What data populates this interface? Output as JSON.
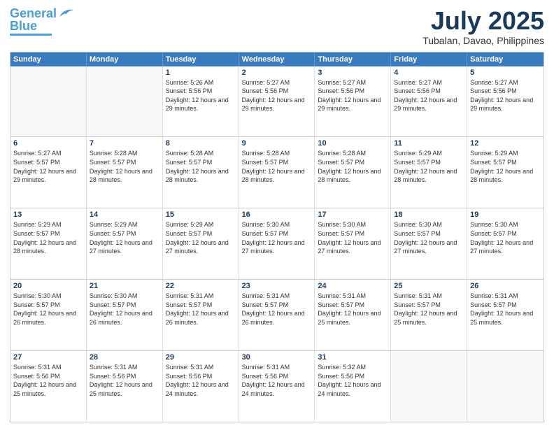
{
  "logo": {
    "line1": "General",
    "line2": "Blue"
  },
  "title": {
    "month_year": "July 2025",
    "location": "Tubalan, Davao, Philippines"
  },
  "calendar": {
    "headers": [
      "Sunday",
      "Monday",
      "Tuesday",
      "Wednesday",
      "Thursday",
      "Friday",
      "Saturday"
    ],
    "rows": [
      [
        {
          "day": "",
          "sunrise": "",
          "sunset": "",
          "daylight": ""
        },
        {
          "day": "",
          "sunrise": "",
          "sunset": "",
          "daylight": ""
        },
        {
          "day": "1",
          "sunrise": "Sunrise: 5:26 AM",
          "sunset": "Sunset: 5:56 PM",
          "daylight": "Daylight: 12 hours and 29 minutes."
        },
        {
          "day": "2",
          "sunrise": "Sunrise: 5:27 AM",
          "sunset": "Sunset: 5:56 PM",
          "daylight": "Daylight: 12 hours and 29 minutes."
        },
        {
          "day": "3",
          "sunrise": "Sunrise: 5:27 AM",
          "sunset": "Sunset: 5:56 PM",
          "daylight": "Daylight: 12 hours and 29 minutes."
        },
        {
          "day": "4",
          "sunrise": "Sunrise: 5:27 AM",
          "sunset": "Sunset: 5:56 PM",
          "daylight": "Daylight: 12 hours and 29 minutes."
        },
        {
          "day": "5",
          "sunrise": "Sunrise: 5:27 AM",
          "sunset": "Sunset: 5:56 PM",
          "daylight": "Daylight: 12 hours and 29 minutes."
        }
      ],
      [
        {
          "day": "6",
          "sunrise": "Sunrise: 5:27 AM",
          "sunset": "Sunset: 5:57 PM",
          "daylight": "Daylight: 12 hours and 29 minutes."
        },
        {
          "day": "7",
          "sunrise": "Sunrise: 5:28 AM",
          "sunset": "Sunset: 5:57 PM",
          "daylight": "Daylight: 12 hours and 28 minutes."
        },
        {
          "day": "8",
          "sunrise": "Sunrise: 5:28 AM",
          "sunset": "Sunset: 5:57 PM",
          "daylight": "Daylight: 12 hours and 28 minutes."
        },
        {
          "day": "9",
          "sunrise": "Sunrise: 5:28 AM",
          "sunset": "Sunset: 5:57 PM",
          "daylight": "Daylight: 12 hours and 28 minutes."
        },
        {
          "day": "10",
          "sunrise": "Sunrise: 5:28 AM",
          "sunset": "Sunset: 5:57 PM",
          "daylight": "Daylight: 12 hours and 28 minutes."
        },
        {
          "day": "11",
          "sunrise": "Sunrise: 5:29 AM",
          "sunset": "Sunset: 5:57 PM",
          "daylight": "Daylight: 12 hours and 28 minutes."
        },
        {
          "day": "12",
          "sunrise": "Sunrise: 5:29 AM",
          "sunset": "Sunset: 5:57 PM",
          "daylight": "Daylight: 12 hours and 28 minutes."
        }
      ],
      [
        {
          "day": "13",
          "sunrise": "Sunrise: 5:29 AM",
          "sunset": "Sunset: 5:57 PM",
          "daylight": "Daylight: 12 hours and 28 minutes."
        },
        {
          "day": "14",
          "sunrise": "Sunrise: 5:29 AM",
          "sunset": "Sunset: 5:57 PM",
          "daylight": "Daylight: 12 hours and 27 minutes."
        },
        {
          "day": "15",
          "sunrise": "Sunrise: 5:29 AM",
          "sunset": "Sunset: 5:57 PM",
          "daylight": "Daylight: 12 hours and 27 minutes."
        },
        {
          "day": "16",
          "sunrise": "Sunrise: 5:30 AM",
          "sunset": "Sunset: 5:57 PM",
          "daylight": "Daylight: 12 hours and 27 minutes."
        },
        {
          "day": "17",
          "sunrise": "Sunrise: 5:30 AM",
          "sunset": "Sunset: 5:57 PM",
          "daylight": "Daylight: 12 hours and 27 minutes."
        },
        {
          "day": "18",
          "sunrise": "Sunrise: 5:30 AM",
          "sunset": "Sunset: 5:57 PM",
          "daylight": "Daylight: 12 hours and 27 minutes."
        },
        {
          "day": "19",
          "sunrise": "Sunrise: 5:30 AM",
          "sunset": "Sunset: 5:57 PM",
          "daylight": "Daylight: 12 hours and 27 minutes."
        }
      ],
      [
        {
          "day": "20",
          "sunrise": "Sunrise: 5:30 AM",
          "sunset": "Sunset: 5:57 PM",
          "daylight": "Daylight: 12 hours and 26 minutes."
        },
        {
          "day": "21",
          "sunrise": "Sunrise: 5:30 AM",
          "sunset": "Sunset: 5:57 PM",
          "daylight": "Daylight: 12 hours and 26 minutes."
        },
        {
          "day": "22",
          "sunrise": "Sunrise: 5:31 AM",
          "sunset": "Sunset: 5:57 PM",
          "daylight": "Daylight: 12 hours and 26 minutes."
        },
        {
          "day": "23",
          "sunrise": "Sunrise: 5:31 AM",
          "sunset": "Sunset: 5:57 PM",
          "daylight": "Daylight: 12 hours and 26 minutes."
        },
        {
          "day": "24",
          "sunrise": "Sunrise: 5:31 AM",
          "sunset": "Sunset: 5:57 PM",
          "daylight": "Daylight: 12 hours and 25 minutes."
        },
        {
          "day": "25",
          "sunrise": "Sunrise: 5:31 AM",
          "sunset": "Sunset: 5:57 PM",
          "daylight": "Daylight: 12 hours and 25 minutes."
        },
        {
          "day": "26",
          "sunrise": "Sunrise: 5:31 AM",
          "sunset": "Sunset: 5:57 PM",
          "daylight": "Daylight: 12 hours and 25 minutes."
        }
      ],
      [
        {
          "day": "27",
          "sunrise": "Sunrise: 5:31 AM",
          "sunset": "Sunset: 5:56 PM",
          "daylight": "Daylight: 12 hours and 25 minutes."
        },
        {
          "day": "28",
          "sunrise": "Sunrise: 5:31 AM",
          "sunset": "Sunset: 5:56 PM",
          "daylight": "Daylight: 12 hours and 25 minutes."
        },
        {
          "day": "29",
          "sunrise": "Sunrise: 5:31 AM",
          "sunset": "Sunset: 5:56 PM",
          "daylight": "Daylight: 12 hours and 24 minutes."
        },
        {
          "day": "30",
          "sunrise": "Sunrise: 5:31 AM",
          "sunset": "Sunset: 5:56 PM",
          "daylight": "Daylight: 12 hours and 24 minutes."
        },
        {
          "day": "31",
          "sunrise": "Sunrise: 5:32 AM",
          "sunset": "Sunset: 5:56 PM",
          "daylight": "Daylight: 12 hours and 24 minutes."
        },
        {
          "day": "",
          "sunrise": "",
          "sunset": "",
          "daylight": ""
        },
        {
          "day": "",
          "sunrise": "",
          "sunset": "",
          "daylight": ""
        }
      ]
    ]
  }
}
